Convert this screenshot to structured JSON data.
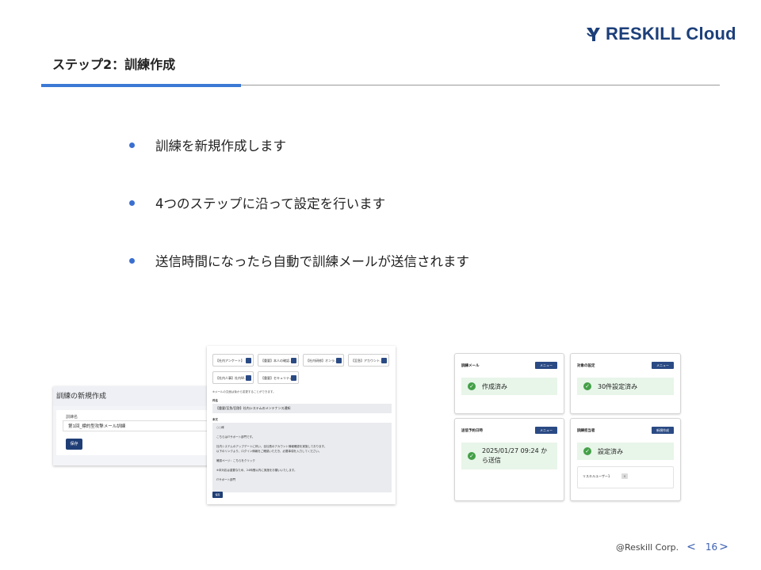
{
  "header": {
    "brand": "RESKILL Cloud",
    "title": "ステップ2：訓練作成"
  },
  "bullets": [
    "訓練を新規作成します",
    "4つのステップに沿って設定を行います",
    "送信時間になったら自動で訓練メールが送信されます"
  ],
  "screenshot_create": {
    "heading": "訓練の新規作成",
    "field_label": "訓練名",
    "field_value": "第1回_標的型攻撃メール訓練",
    "save_label": "保存"
  },
  "screenshot_mail": {
    "chips": [
      "【社内アンケート】",
      "【重要】本人の確認…",
      "【社内研修】オンラ…",
      "【至急】アカウント…",
      "【社内人事】社内W…",
      "【重要】セキュリティ…"
    ],
    "note": "※メールの文面は後から変更することができます。",
    "subject_label": "件名",
    "subject_value": "【重要/至急/回答】社内システムのメンテナンス通知",
    "body_label": "本文",
    "body_lines": [
      "○○様",
      "こちらはITサポート部門です。",
      "社内システムのアップデートに伴い、全社員のアカウント情報確認を実施しております。",
      "以下のリンクより、ログイン情報をご確認いただき、必要事項を入力してください。",
      "確認ページ：こちらをクリック",
      "※本対応は重要なため、24時間以内に実施をお願いいたします。",
      "ITサポート部門"
    ],
    "save_label": "保存"
  },
  "cards": {
    "mail": {
      "title": "訓練メール",
      "button": "メニュー",
      "status": "作成済み"
    },
    "targets": {
      "title": "対象の設定",
      "button": "メニュー",
      "status": "30件設定済み"
    },
    "schedule": {
      "title": "送信予約日時",
      "button": "メニュー",
      "status": "2025/01/27 09:24 から送信"
    },
    "manager": {
      "title": "訓練担当者",
      "button": "新規作成",
      "status": "設定済み",
      "user": "リスキルユーザー1"
    }
  },
  "footer": {
    "copyright": "@Reskill Corp.",
    "prev": "<",
    "page": "16",
    "next": ">"
  },
  "colors": {
    "accent": "#3b79d5",
    "brand": "#1c3f7a",
    "status_ok": "#43a047"
  }
}
